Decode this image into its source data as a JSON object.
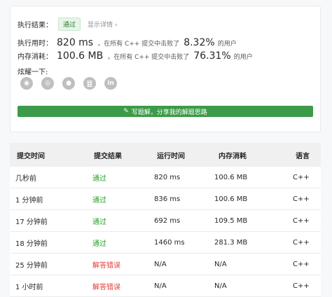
{
  "result": {
    "label": "执行结果：",
    "badge": "通过",
    "details_link": "显示详情 ›"
  },
  "runtime": {
    "label": "执行用时：",
    "value": "820 ms",
    "mid": "，在所有 C++ 提交中击败了",
    "pct": "8.32%",
    "tail": "的用户"
  },
  "memory": {
    "label": "内存消耗：",
    "value": "100.6 MB",
    "mid": "，在所有 C++ 提交中击败了",
    "pct": "76.31%",
    "tail": "的用户"
  },
  "share": {
    "label": "炫耀一下:",
    "icons": [
      {
        "name": "wechat-icon",
        "glyph": "◉"
      },
      {
        "name": "weibo-icon",
        "glyph": "◎"
      },
      {
        "name": "qq-icon",
        "glyph": "●"
      },
      {
        "name": "douban-icon",
        "glyph": "豆"
      },
      {
        "name": "linkedin-icon",
        "glyph": "in"
      }
    ],
    "button_label": "写题解，分享我的解题思路"
  },
  "table": {
    "headers": [
      "提交时间",
      "提交结果",
      "运行时间",
      "内存消耗",
      "语言"
    ],
    "rows": [
      {
        "time": "几秒前",
        "result": "通过",
        "status": "ok",
        "runtime": "820 ms",
        "memory": "100.6 MB",
        "lang": "C++"
      },
      {
        "time": "1 分钟前",
        "result": "通过",
        "status": "ok",
        "runtime": "836 ms",
        "memory": "100.6 MB",
        "lang": "C++"
      },
      {
        "time": "17 分钟前",
        "result": "通过",
        "status": "ok",
        "runtime": "692 ms",
        "memory": "109.5 MB",
        "lang": "C++"
      },
      {
        "time": "18 分钟前",
        "result": "通过",
        "status": "ok",
        "runtime": "1460 ms",
        "memory": "281.3 MB",
        "lang": "C++"
      },
      {
        "time": "25 分钟前",
        "result": "解答错误",
        "status": "err",
        "runtime": "N/A",
        "memory": "N/A",
        "lang": "C++"
      },
      {
        "time": "1 小时前",
        "result": "解答错误",
        "status": "err",
        "runtime": "N/A",
        "memory": "N/A",
        "lang": "C++"
      }
    ]
  },
  "colors": {
    "accent_green": "#3c9b48",
    "pass_green": "#2ca02c",
    "error_red": "#e53935"
  }
}
